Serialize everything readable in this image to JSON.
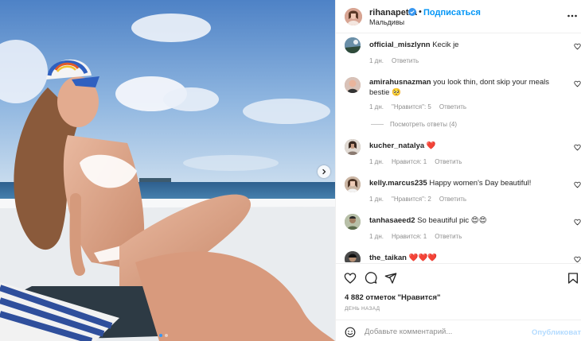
{
  "post": {
    "carousel_dots": 2,
    "active_dot": 0
  },
  "header": {
    "username": "rihanapetra",
    "separator": "•",
    "follow_label": "Подписаться",
    "location": "Мальдивы"
  },
  "comments": [
    {
      "user": "official_miszlynn",
      "text": "Kecik je",
      "time": "1 дн.",
      "likes": "",
      "reply": "Ответить"
    },
    {
      "user": "amirahusnazman",
      "text": "you look thin, dont skip your meals bestie 🥺",
      "time": "1 дн.",
      "likes": "\"Нравится\": 5",
      "reply": "Ответить"
    },
    {
      "user": "kucher_natalya",
      "text": "❤️",
      "time": "1 дн.",
      "likes": "Нравится: 1",
      "reply": "Ответить"
    },
    {
      "user": "kelly.marcus235",
      "text": "Happy women's Day beautiful!",
      "time": "1 дн.",
      "likes": "\"Нравится\": 2",
      "reply": "Ответить"
    },
    {
      "user": "tanhasaeed2",
      "text": "So beautiful pic 😍😍",
      "time": "1 дн.",
      "likes": "Нравится: 1",
      "reply": "Ответить"
    },
    {
      "user": "the_taikan",
      "text": "❤️❤️❤️",
      "time": "",
      "likes": "",
      "reply": ""
    }
  ],
  "view_replies": "Посмотреть ответы (4)",
  "footer": {
    "likes": "4 882 отметок \"Нравится\"",
    "time": "ДЕНЬ НАЗАД",
    "comment_placeholder": "Добавьте комментарий...",
    "publish_label": "Опубликовать"
  },
  "colors": {
    "accent": "#0095f6",
    "publish_disabled": "#b3dbff",
    "heart": "#ed4956",
    "muted": "#8e8e8e",
    "text": "#262626"
  },
  "icons": [
    "verified-badge-icon",
    "more-options-icon",
    "heart-icon",
    "comment-icon",
    "share-icon",
    "bookmark-icon",
    "emoji-icon",
    "chevron-right-icon"
  ]
}
